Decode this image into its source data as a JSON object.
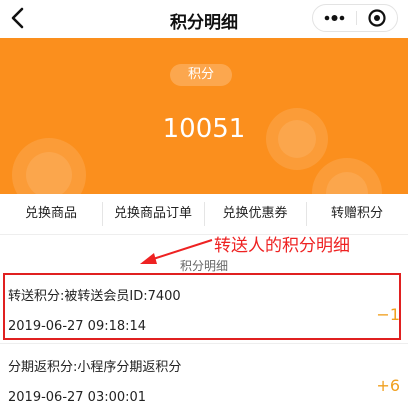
{
  "navbar": {
    "title": "积分明细",
    "back_icon": "chevron-left-icon",
    "more_icon": "more-dots-icon",
    "close_icon": "target-circle-icon"
  },
  "summary": {
    "label": "积分",
    "points": "10051",
    "background_color": "#fb8f1d"
  },
  "tabs": [
    {
      "label": "兑换商品"
    },
    {
      "label": "兑换商品订单"
    },
    {
      "label": "兑换优惠券"
    },
    {
      "label": "转赠积分"
    }
  ],
  "section_title": "积分明细",
  "annotation": {
    "text": "转送人的积分明细",
    "color": "#ee2222"
  },
  "records": [
    {
      "description": "转送积分:被转送会员ID:7400",
      "time": "2019-06-27 09:18:14",
      "delta": "−1"
    },
    {
      "description": "分期返积分:小程序分期返积分",
      "time": "2019-06-27 03:00:01",
      "delta": "+6"
    }
  ]
}
